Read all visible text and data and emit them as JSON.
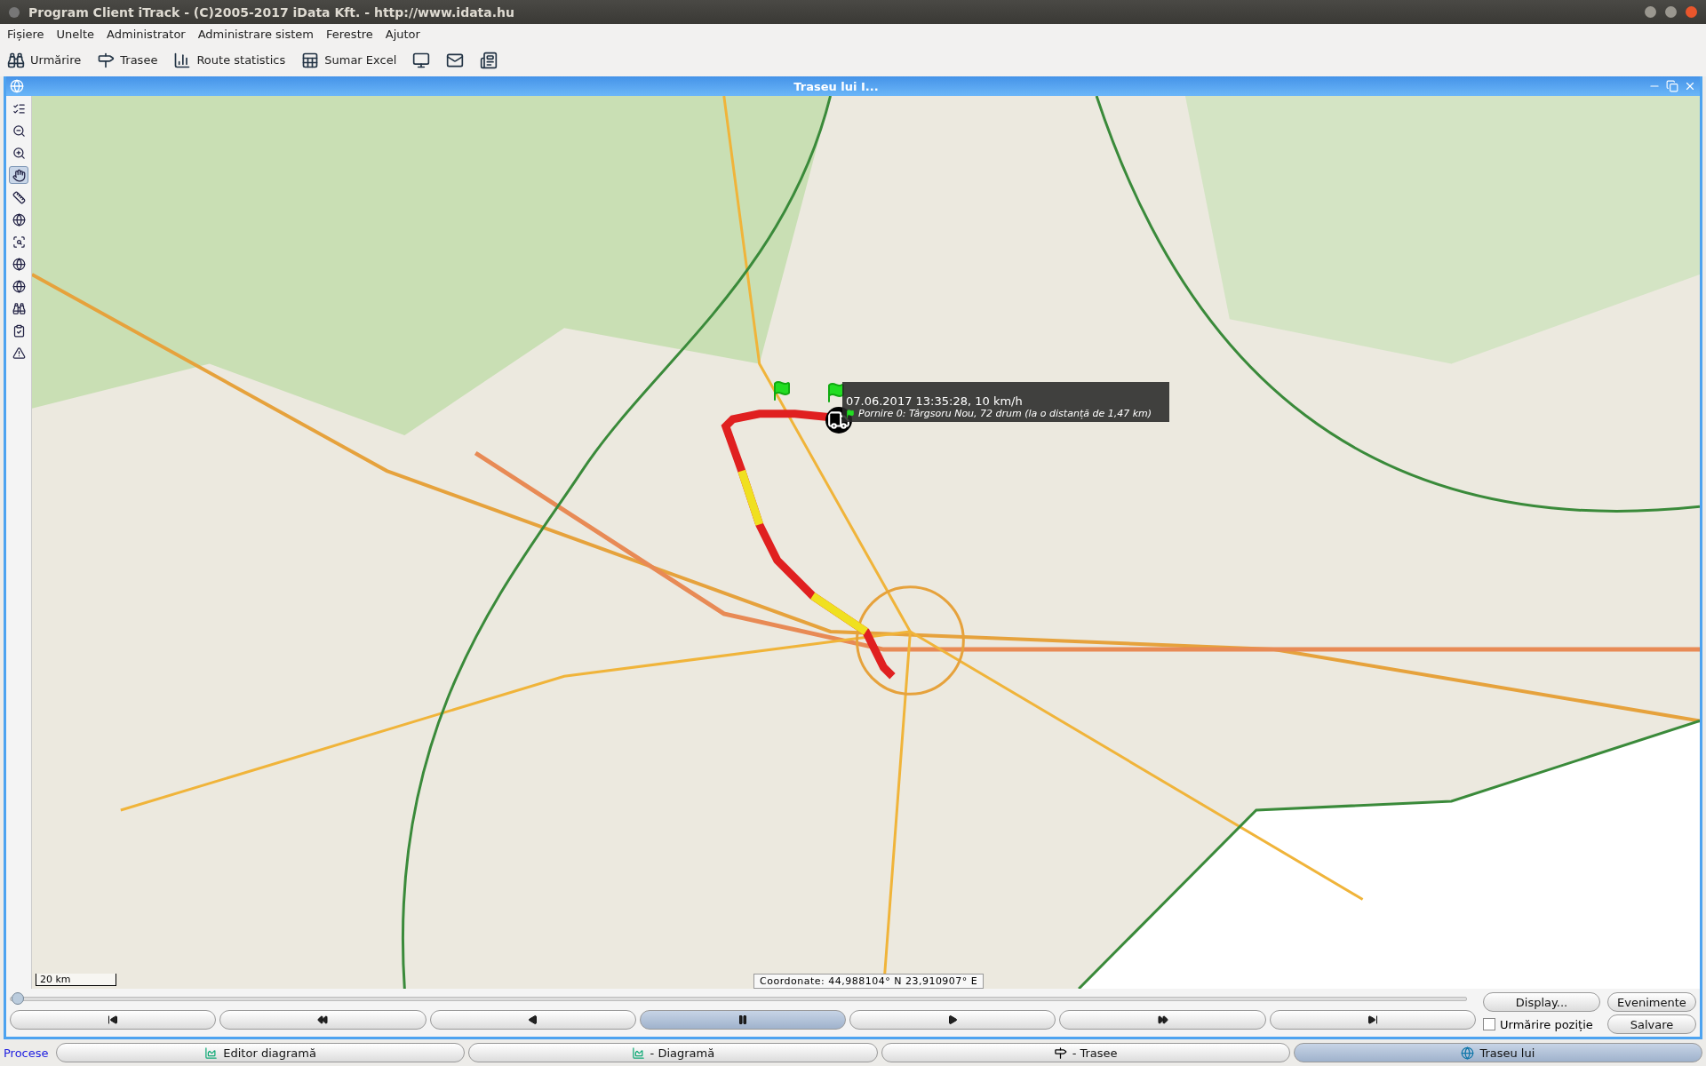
{
  "window": {
    "title": "Program Client iTrack - (C)2005-2017 iData Kft. - http://www.idata.hu"
  },
  "menu": [
    {
      "label": "Fișiere"
    },
    {
      "label": "Unelte"
    },
    {
      "label": "Administrator"
    },
    {
      "label": "Administrare sistem"
    },
    {
      "label": "Ferestre"
    },
    {
      "label": "Ajutor"
    }
  ],
  "toolbar": [
    {
      "kind": "tracking",
      "label": "Urmărire"
    },
    {
      "kind": "routes",
      "label": "Trasee"
    },
    {
      "kind": "stats",
      "label": "Route statistics"
    },
    {
      "kind": "excel",
      "label": "Sumar Excel"
    },
    {
      "kind": "network"
    },
    {
      "kind": "mail"
    },
    {
      "kind": "report"
    }
  ],
  "frame": {
    "title": "Traseu lui I..."
  },
  "tools": [
    {
      "kind": "layers",
      "selected": false
    },
    {
      "kind": "zoom-out",
      "selected": false
    },
    {
      "kind": "zoom-in",
      "selected": false
    },
    {
      "kind": "pan",
      "selected": true
    },
    {
      "kind": "ruler",
      "selected": false
    },
    {
      "kind": "globe",
      "selected": false
    },
    {
      "kind": "search-map",
      "selected": false
    },
    {
      "kind": "globe",
      "selected": false
    },
    {
      "kind": "globe",
      "selected": false
    },
    {
      "kind": "binoculars",
      "selected": false
    },
    {
      "kind": "clipboard",
      "selected": false
    },
    {
      "kind": "warning",
      "selected": false
    }
  ],
  "map": {
    "tooltip": {
      "time": "07.06.2017 13:35:28, 10 km/h",
      "detail": "Pornire 0: Târgsoru Nou, 72 drum (la o distanță de 1,47 km)"
    },
    "scale": "20 km",
    "coordinates": "Coordonate: 44,988104° N 23,910907° E"
  },
  "timeline": {
    "level": 0
  },
  "playback": [
    {
      "kind": "first",
      "selected": false
    },
    {
      "kind": "rewind",
      "selected": false
    },
    {
      "kind": "back",
      "selected": false
    },
    {
      "kind": "pause",
      "selected": true
    },
    {
      "kind": "play",
      "selected": false
    },
    {
      "kind": "forward",
      "selected": false
    },
    {
      "kind": "last",
      "selected": false
    }
  ],
  "actions": {
    "display": "Display...",
    "events": "Evenimente",
    "save": "Salvare",
    "follow": {
      "label": "Urmărire poziție",
      "checked": false
    }
  },
  "taskbar": {
    "label": "Procese",
    "items": [
      {
        "kind": "chart",
        "label": "Editor diagramă",
        "selected": false
      },
      {
        "kind": "chart",
        "label": "- Diagramă",
        "selected": false
      },
      {
        "kind": "road",
        "label": "- Trasee",
        "selected": false
      },
      {
        "kind": "globe",
        "label": "Traseu lui",
        "selected": true
      }
    ]
  }
}
